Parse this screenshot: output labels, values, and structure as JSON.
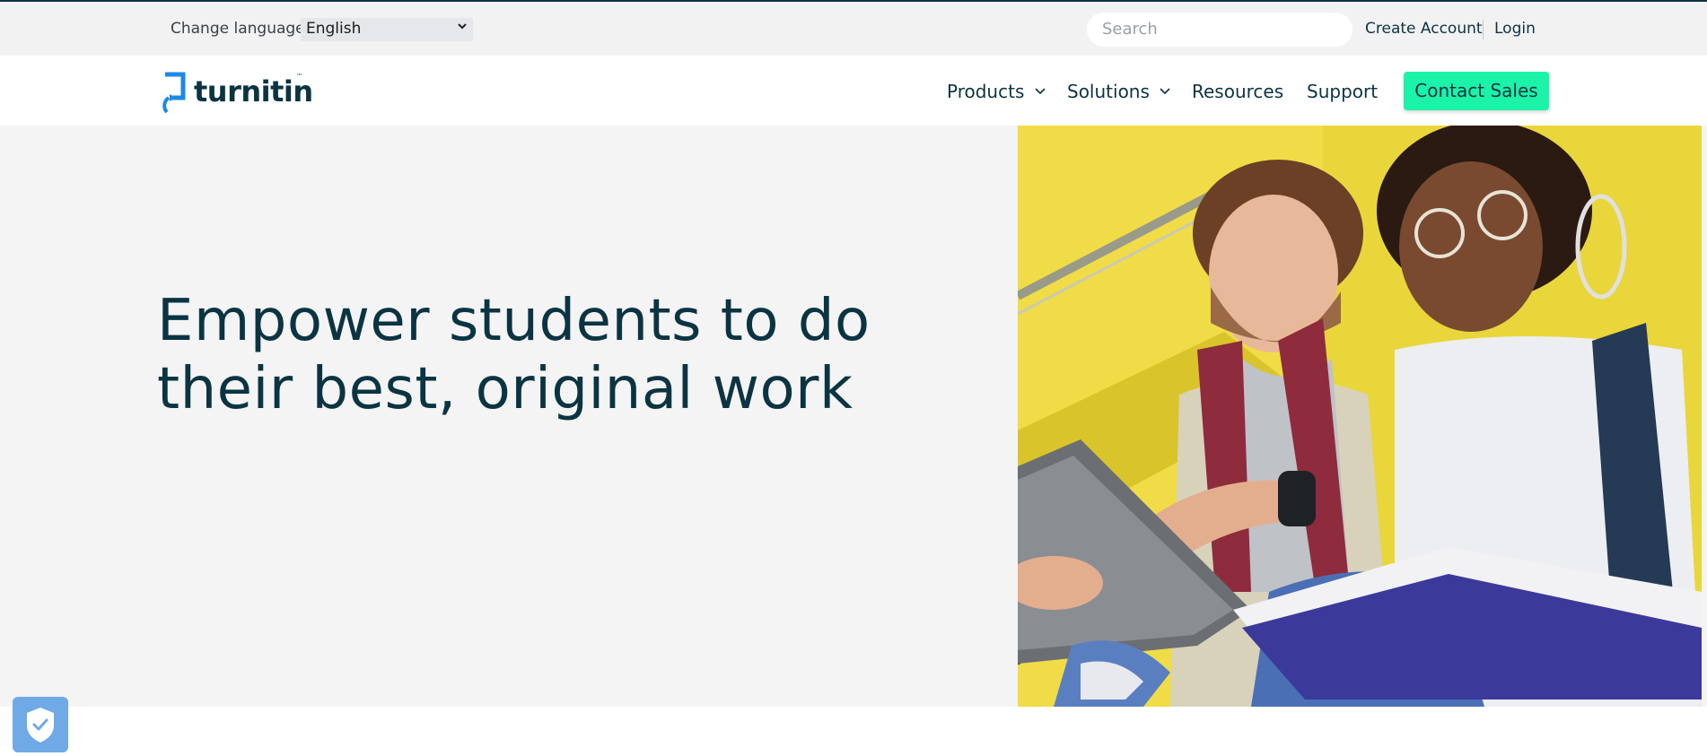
{
  "utility_bar": {
    "change_language_label": "Change language",
    "language_selected": "English",
    "search_placeholder": "Search",
    "create_account": "Create Account",
    "login": "Login"
  },
  "nav": {
    "logo_text": "turnitin",
    "logo_tm": "™",
    "items": [
      {
        "label": "Products",
        "has_dropdown": true
      },
      {
        "label": "Solutions",
        "has_dropdown": true
      },
      {
        "label": "Resources",
        "has_dropdown": false
      },
      {
        "label": "Support",
        "has_dropdown": false
      }
    ],
    "cta_label": "Contact Sales"
  },
  "hero": {
    "title_line1": "Empower students to do",
    "title_line2": "their best, original work",
    "image": "students-with-tablet-photo"
  },
  "colors": {
    "brand_dark": "#0b3443",
    "cta_green": "#1bf3a9",
    "logo_blue": "#1b8ae6",
    "hero_bg": "#f4f4f4",
    "topbar_bg": "#f2f2f3"
  }
}
